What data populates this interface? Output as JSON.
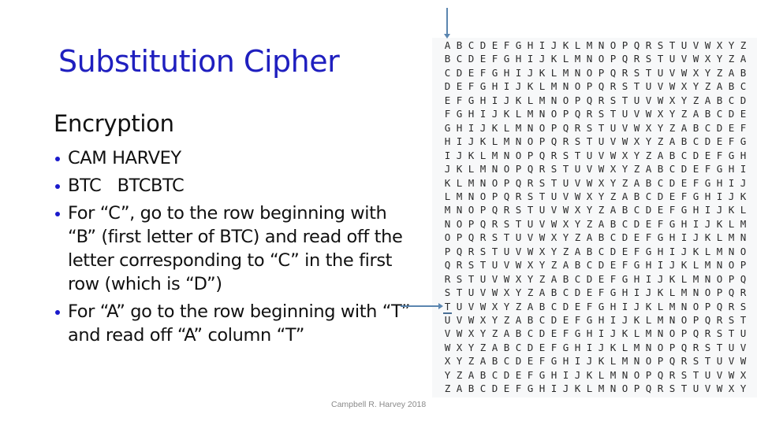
{
  "slide": {
    "title": "Substitution Cipher",
    "section_heading": "Encryption",
    "bullets": [
      "CAM HARVEY",
      "BTC   BTCBTC",
      "For “C”, go to the row beginning with “B” (first letter of BTC) and read off the letter corresponding to “C” in the first row (which is “D”)",
      "For “A” go to the row beginning with “T” and read off “A” column “T”"
    ],
    "footer": "Campbell R. Harvey 2018"
  },
  "vigenere_table": {
    "alphabet": "ABCDEFGHIJKLMNOPQRSTUVWXYZ",
    "rows": [
      "ABCDEFGHIJKLMNOPQRSTUVWXYZ",
      "BCDEFGHIJKLMNOPQRSTUVWXYZA",
      "CDEFGHIJKLMNOPQRSTUVWXYZAB",
      "DEFGHIJKLMNOPQRSTUVWXYZABC",
      "EFGHIJKLMNOPQRSTUVWXYZABCD",
      "FGHIJKLMNOPQRSTUVWXYZABCDE",
      "GHIJKLMNOPQRSTUVWXYZABCDEF",
      "HIJKLMNOPQRSTUVWXYZABCDEFG",
      "IJKLMNOPQRSTUVWXYZABCDEFGH",
      "JKLMNOPQRSTUVWXYZABCDEFGHI",
      "KLMNOPQRSTUVWXYZABCDEFGHIJ",
      "LMNOPQRSTUVWXYZABCDEFGHIJK",
      "MNOPQRSTUVWXYZABCDEFGHIJKL",
      "NOPQRSTUVWXYZABCDEFGHIJKLM",
      "OPQRSTUVWXYZABCDEFGHIJKLMN",
      "PQRSTUVWXYZABCDEFGHIJKLMNO",
      "QRSTUVWXYZABCDEFGHIJKLMNOP",
      "RSTUVWXYZABCDEFGHIJKLMNOPQ",
      "STUVWXYZABCDEFGHIJKLMNOPQR",
      "TUVWXYZABCDEFGHIJKLMNOPQRS",
      "UVWXYZABCDEFGHIJKLMNOPQRST",
      "VWXYZABCDEFGHIJKLMNOPQRSTU",
      "WXYZABCDEFGHIJKLMNOPQRSTUV",
      "XYZABCDEFGHIJKLMNOPQRSTUVW",
      "YZABCDEFGHIJKLMNOPQRSTUVWX",
      "ZABCDEFGHIJKLMNOPQRSTUVWXY"
    ],
    "highlighted_row_letter": "T",
    "highlighted_column_letter": "A"
  },
  "colors": {
    "title": "#1f1fbf",
    "bullet": "#1a1acc",
    "arrow": "#5b86b0",
    "table_background": "#f7f8f9",
    "footer": "#8a8a8a"
  }
}
